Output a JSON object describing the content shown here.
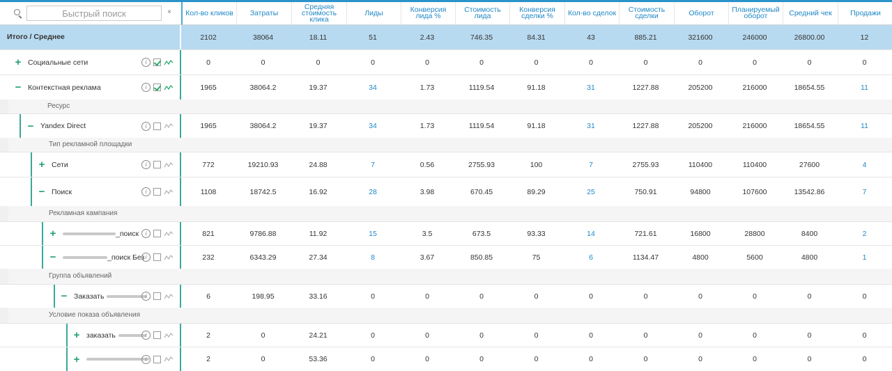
{
  "search": {
    "placeholder": "Быстрый поиск",
    "clear": "×"
  },
  "columns": [
    {
      "label": "Кол-во кликов"
    },
    {
      "label": "Затраты"
    },
    {
      "label": "Средняя стоимость клика"
    },
    {
      "label": "Лиды"
    },
    {
      "label": "Конверсия лида %"
    },
    {
      "label": "Стоимость лида"
    },
    {
      "label": "Конверсия сделки %"
    },
    {
      "label": "Кол-во сделок"
    },
    {
      "label": "Стоимость сделки"
    },
    {
      "label": "Оборот"
    },
    {
      "label": "Планируемый оборот"
    },
    {
      "label": "Средний чек"
    },
    {
      "label": "Продажи"
    }
  ],
  "total": {
    "label": "Итого / Среднее",
    "values": [
      "2102",
      "38064",
      "18.11",
      "51",
      "2.43",
      "746.35",
      "84.31",
      "43",
      "885.21",
      "321600",
      "246000",
      "26800.00",
      "12"
    ]
  },
  "rows": [
    {
      "kind": "data",
      "label": "Социальные сети",
      "toggle": "+",
      "checked": true,
      "active": true,
      "values": [
        "0",
        "0",
        "0",
        "0",
        "0",
        "0",
        "0",
        "0",
        "0",
        "0",
        "0",
        "0",
        "0"
      ]
    },
    {
      "kind": "data",
      "label": "Контекстная реклама",
      "toggle": "−",
      "checked": true,
      "active": true,
      "values": [
        "1965",
        "38064.2",
        "19.37",
        "34",
        "1.73",
        "1119.54",
        "91.18",
        "31",
        "1227.88",
        "205200",
        "216000",
        "18654.55",
        "11"
      ]
    },
    {
      "kind": "sub",
      "label": "Ресурс"
    },
    {
      "kind": "data",
      "label": "Yandex Direct",
      "toggle": "−",
      "checked": false,
      "active": false,
      "values": [
        "1965",
        "38064.2",
        "19.37",
        "34",
        "1.73",
        "1119.54",
        "91.18",
        "31",
        "1227.88",
        "205200",
        "216000",
        "18654.55",
        "11"
      ]
    },
    {
      "kind": "sub",
      "label": "Тип рекламной площадки"
    },
    {
      "kind": "data",
      "label": "Сети",
      "toggle": "+",
      "checked": false,
      "active": false,
      "values": [
        "772",
        "19210.93",
        "24.88",
        "7",
        "0.56",
        "2755.93",
        "100",
        "7",
        "2755.93",
        "110400",
        "110400",
        "27600",
        "4"
      ]
    },
    {
      "kind": "data",
      "label": "Поиск",
      "toggle": "−",
      "checked": false,
      "active": false,
      "values": [
        "1108",
        "18742.5",
        "16.92",
        "28",
        "3.98",
        "670.45",
        "89.29",
        "25",
        "750.91",
        "94800",
        "107600",
        "13542.86",
        "7"
      ]
    },
    {
      "kind": "sub",
      "label": "Рекламная кампания"
    },
    {
      "kind": "data",
      "label": "_поиск",
      "toggle": "+",
      "checked": false,
      "active": false,
      "values": [
        "821",
        "9786.88",
        "11.92",
        "15",
        "3.5",
        "673.5",
        "93.33",
        "14",
        "721.61",
        "16800",
        "28800",
        "8400",
        "2"
      ]
    },
    {
      "kind": "data",
      "label": "_поиск Без",
      "toggle": "−",
      "checked": false,
      "active": false,
      "values": [
        "232",
        "6343.29",
        "27.34",
        "8",
        "3.67",
        "850.85",
        "75",
        "6",
        "1134.47",
        "4800",
        "5600",
        "4800",
        "1"
      ]
    },
    {
      "kind": "sub",
      "label": "Группа объявлений"
    },
    {
      "kind": "data",
      "label": "Заказать",
      "toggle": "−",
      "checked": false,
      "active": false,
      "values": [
        "6",
        "198.95",
        "33.16",
        "0",
        "0",
        "0",
        "0",
        "0",
        "0",
        "0",
        "0",
        "0",
        "0"
      ]
    },
    {
      "kind": "sub",
      "label": "Условие показа объявления"
    },
    {
      "kind": "data",
      "label": "заказать",
      "toggle": "+",
      "checked": false,
      "active": false,
      "values": [
        "2",
        "0",
        "24.21",
        "0",
        "0",
        "0",
        "0",
        "0",
        "0",
        "0",
        "0",
        "0",
        "0"
      ]
    },
    {
      "kind": "data",
      "label": "",
      "toggle": "+",
      "checked": false,
      "active": false,
      "values": [
        "2",
        "0",
        "53.36",
        "0",
        "0",
        "0",
        "0",
        "0",
        "0",
        "0",
        "0",
        "0",
        "0"
      ]
    }
  ],
  "colors": {
    "accent": "#1e88c7",
    "tree": "#3aa89a",
    "toggle": "#22a07a",
    "totalBg": "#b8daf0"
  }
}
